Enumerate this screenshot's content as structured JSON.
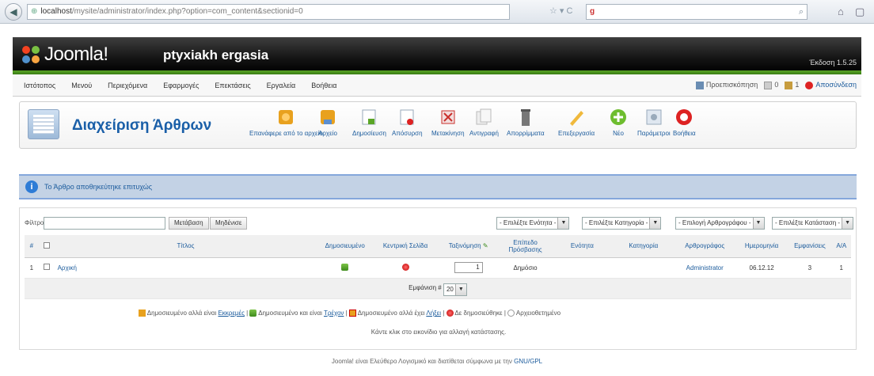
{
  "browser": {
    "url_host": "localhost",
    "url_path": "/mysite/administrator/index.php?option=com_content&sectionid=0"
  },
  "header": {
    "logo": "Joomla!",
    "site_name": "ptyxiakh ergasia",
    "version": "Έκδοση 1.5.25"
  },
  "menu": {
    "items": [
      "Ιστότοπος",
      "Μενού",
      "Περιεχόμενα",
      "Εφαρμογές",
      "Επεκτάσεις",
      "Εργαλεία",
      "Βοήθεια"
    ],
    "preview": "Προεπισκόπηση",
    "messages_count": "0",
    "users_count": "1",
    "logout": "Αποσύνδεση"
  },
  "toolbar": {
    "title": "Διαχείριση Άρθρων",
    "buttons": [
      "Επανάφερε από το αρχείο",
      "Αρχείο",
      "Δημοσίευση",
      "Απόσυρση",
      "Μετακίνηση",
      "Αντιγραφή",
      "Απορρίμματα",
      "Επεξεργασία",
      "Νέο",
      "Παράμετροι",
      "Βοήθεια"
    ]
  },
  "message": "Το Άρθρο αποθηκεύτηκε επιτυχώς",
  "filters": {
    "label": "Φίλτρο:",
    "go": "Μετάβαση",
    "reset": "Μηδένισε",
    "selects": [
      "- Επιλέξτε Ενότητα -",
      "- Επιλέξτε Κατηγορία -",
      "- Επιλογή Αρθρογράφου -",
      "- Επιλέξτε Κατάσταση -"
    ]
  },
  "table": {
    "headers": [
      "#",
      "",
      "Τίτλος",
      "Δημοσιευμένο",
      "Κεντρική Σελίδα",
      "Ταξινόμηση",
      "Επίπεδο Πρόσβασης",
      "Ενότητα",
      "Κατηγορία",
      "Αρθρογράφος",
      "Ημερομηνία",
      "Εμφανίσεις",
      "Α/Α"
    ],
    "rows": [
      {
        "num": "1",
        "title": "Αρχική",
        "order": "1",
        "access": "Δημόσιο",
        "section": "",
        "category": "",
        "author": "Administrator",
        "date": "06.12.12",
        "hits": "3",
        "id": "1"
      }
    ],
    "display_label": "Εμφάνιση #",
    "display_value": "20"
  },
  "legend": {
    "l1": "Δημοσιευμένο αλλά είναι",
    "l1u": "Εκκρεμές",
    "l2": "Δημοσιευμένο και είναι",
    "l2u": "Τρέχον",
    "l3": "Δημοσιευμένο αλλά έχει",
    "l3u": "Λήξει",
    "l4": "Δε δημοσιεύθηκε",
    "l5": "Αρχειοθετημένο",
    "note": "Κάντε κλικ στο εικονίδιο για αλλαγή κατάστασης."
  },
  "footer": {
    "text": "Joomla! είναι Ελεύθερο Λογισμικό και διατίθεται σύμφωνα με την",
    "link": "GNU/GPL"
  },
  "colors": {
    "accent": "#1b5b9c",
    "green": "#4d9a1f",
    "message_bg": "#c3d2e5"
  }
}
